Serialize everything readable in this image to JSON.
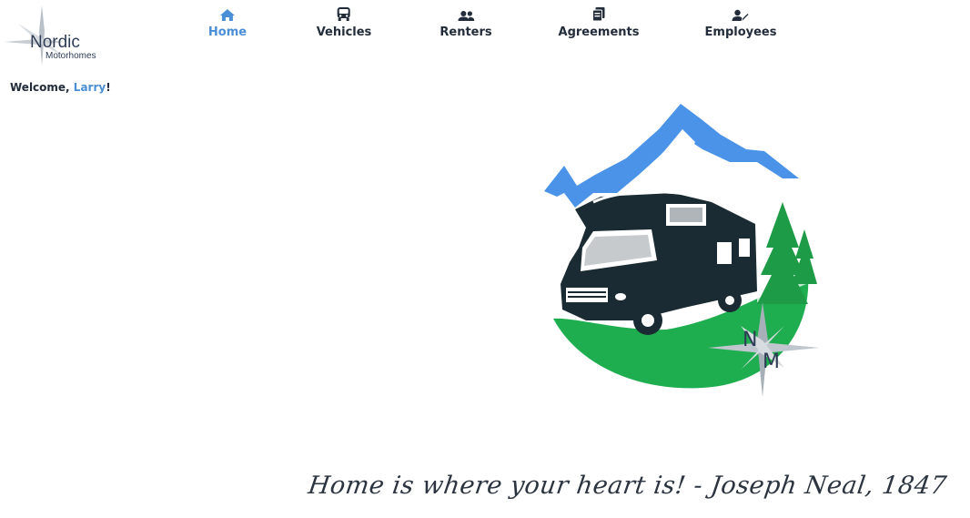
{
  "brand": {
    "name_line1": "Nordic",
    "name_line2": "Motorhomes",
    "emblem_letters": "NM"
  },
  "nav": {
    "items": [
      {
        "label": "Home",
        "icon": "home-icon",
        "active": true
      },
      {
        "label": "Vehicles",
        "icon": "bus-icon",
        "active": false
      },
      {
        "label": "Renters",
        "icon": "users-icon",
        "active": false
      },
      {
        "label": "Agreements",
        "icon": "documents-icon",
        "active": false
      },
      {
        "label": "Employees",
        "icon": "user-edit-icon",
        "active": false
      }
    ]
  },
  "welcome": {
    "prefix": "Welcome, ",
    "user": "Larry",
    "suffix": "!"
  },
  "quote": "Home is where your heart is! - Joseph Neal, 1847",
  "colors": {
    "accent": "#4a8fd6",
    "text": "#222c3a",
    "mountain": "#4a93e8",
    "grass": "#1fae4f",
    "tree": "#1d9b47",
    "vehicle": "#1a2b33"
  }
}
